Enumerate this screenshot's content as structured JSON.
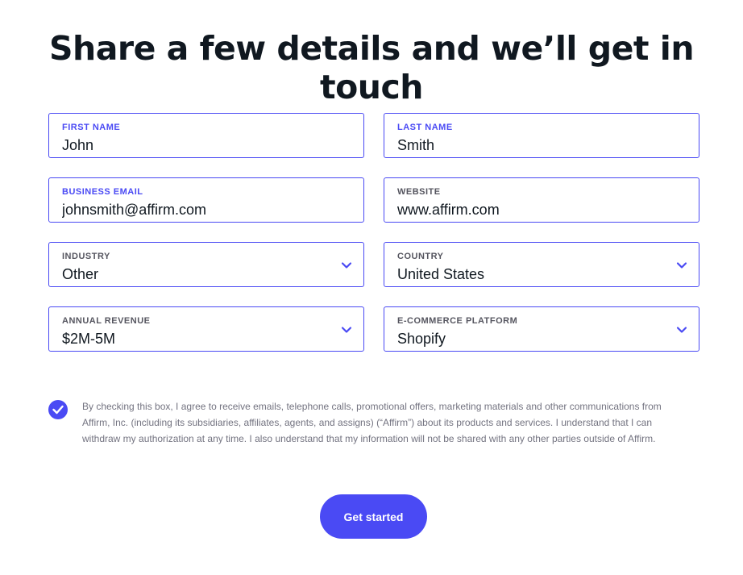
{
  "page": {
    "heading": "Share a few details and we’ll get in touch"
  },
  "form": {
    "first_name": {
      "label": "FIRST NAME",
      "value": "John"
    },
    "last_name": {
      "label": "LAST NAME",
      "value": "Smith"
    },
    "business_email": {
      "label": "BUSINESS EMAIL",
      "value": "johnsmith@affirm.com"
    },
    "website": {
      "label": "WEBSITE",
      "value": "www.affirm.com"
    },
    "industry": {
      "label": "INDUSTRY",
      "value": "Other",
      "icon": "chevron-down-icon"
    },
    "country": {
      "label": "COUNTRY",
      "value": "United States",
      "icon": "chevron-down-icon"
    },
    "annual_revenue": {
      "label": "ANNUAL REVENUE",
      "value": "$2M-5M",
      "icon": "chevron-down-icon"
    },
    "ecommerce_platform": {
      "label": "E-COMMERCE PLATFORM",
      "value": "Shopify",
      "icon": "chevron-down-icon"
    }
  },
  "consent": {
    "checked": true,
    "text": "By checking this box, I agree to receive emails, telephone calls, promotional offers, marketing materials and other communications from Affirm, Inc. (including its subsidiaries, affiliates, agents, and assigns) (“Affirm”) about its products and services. I understand that I can withdraw my authorization at any time. I also understand that my information will not be shared with any other parties outside of Affirm."
  },
  "cta": {
    "label": "Get started"
  },
  "colors": {
    "accent": "#4a4af4",
    "heading": "#101820",
    "label": "#55555f",
    "muted_text": "#737380"
  }
}
